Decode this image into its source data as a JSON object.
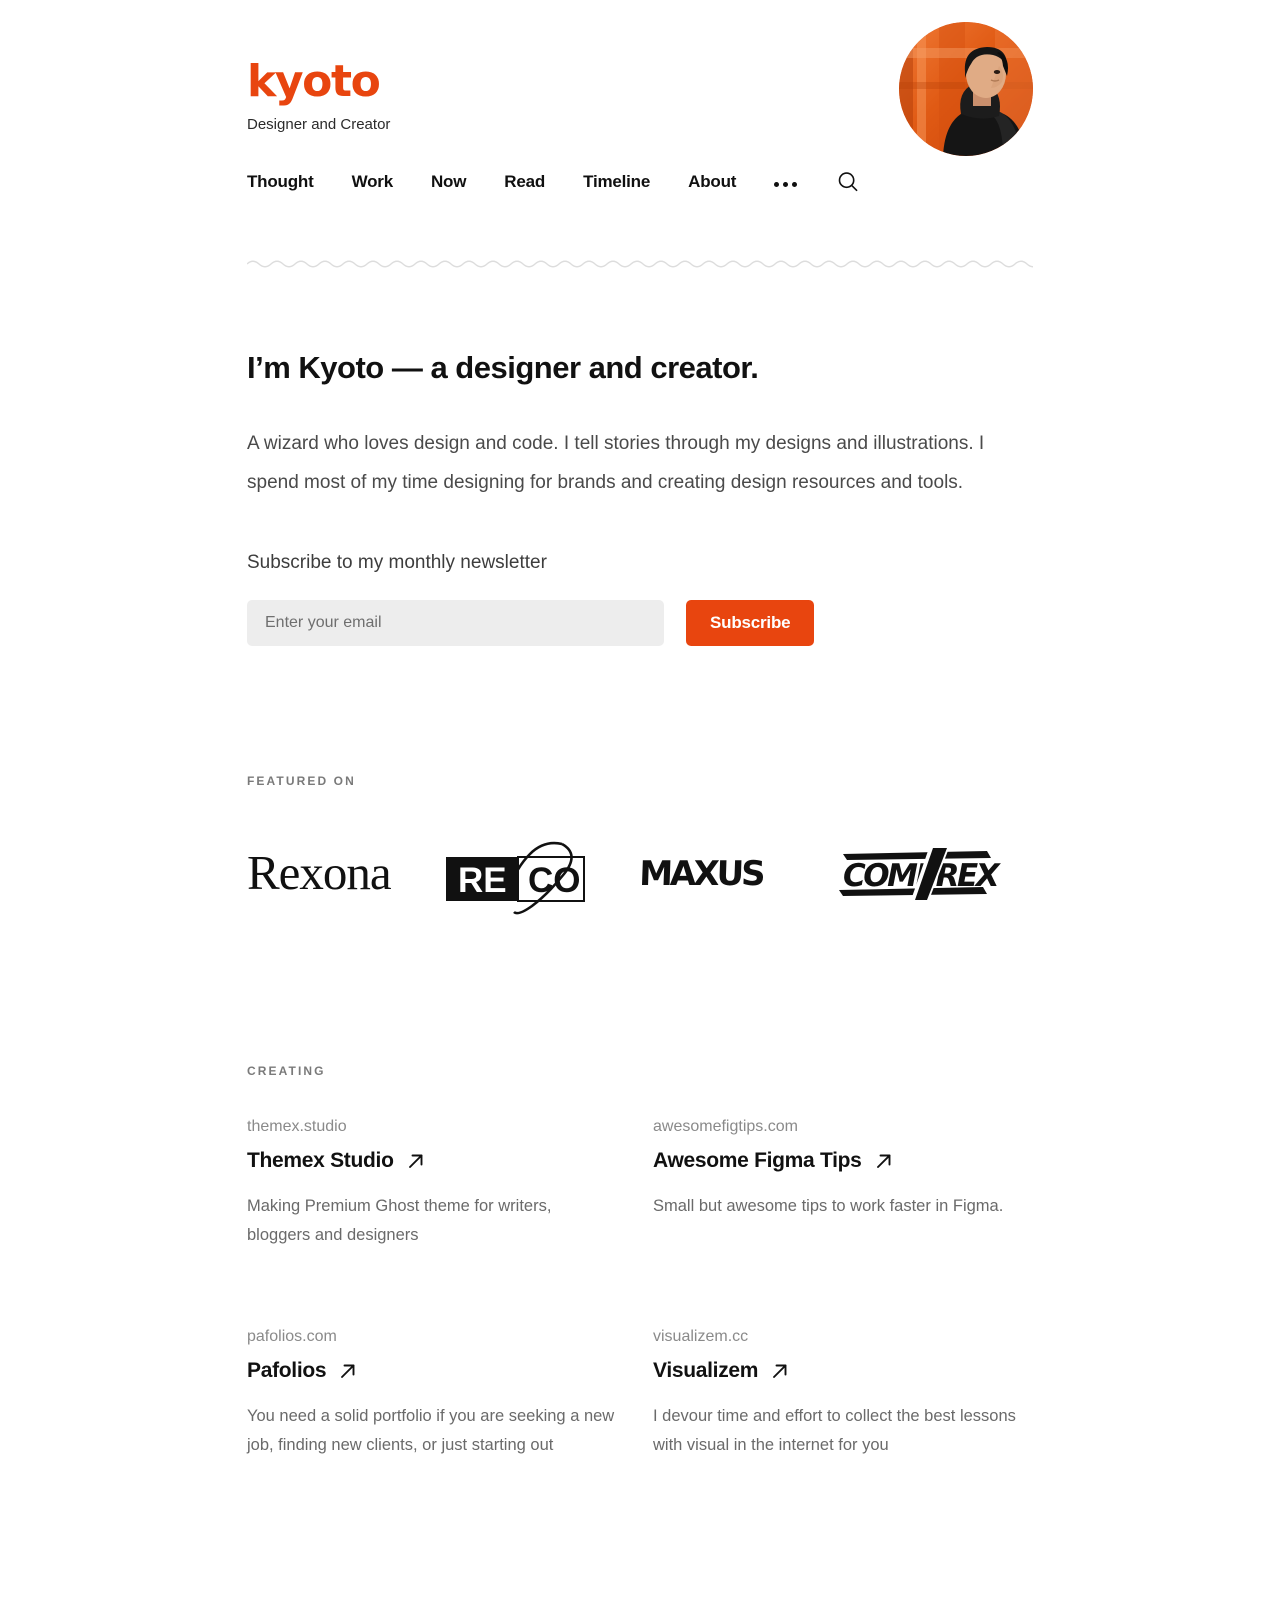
{
  "header": {
    "logo_text": "kyoto",
    "tagline": "Designer and Creator",
    "accent_color": "#E8450F",
    "avatar_alt": "avatar-photo",
    "nav": [
      {
        "label": "Thought"
      },
      {
        "label": "Work"
      },
      {
        "label": "Now"
      },
      {
        "label": "Read"
      },
      {
        "label": "Timeline"
      },
      {
        "label": "About"
      }
    ],
    "more_icon": "ellipsis-icon",
    "search_icon": "search-icon"
  },
  "intro": {
    "title": "I’m Kyoto — a designer and creator.",
    "body": "A wizard who loves design and code. I tell stories through my designs and illustrations. I spend most of my time designing for brands and creating design resources and tools."
  },
  "newsletter": {
    "label": "Subscribe to my monthly newsletter",
    "input_value": "",
    "placeholder": "Enter your email",
    "button_label": "Subscribe",
    "button_color": "#E8450F",
    "input_bg": "#EDEDED"
  },
  "featured": {
    "label": "FEATURED ON",
    "logos": [
      {
        "name": "Rexona",
        "icon": "rexona-logo"
      },
      {
        "name": "RECO",
        "icon": "reco-logo"
      },
      {
        "name": "MAXUS",
        "icon": "maxus-logo"
      },
      {
        "name": "COMPREX",
        "icon": "comprex-logo"
      }
    ]
  },
  "creating": {
    "label": "CREATING",
    "cards": [
      {
        "domain": "themex.studio",
        "title": "Themex Studio",
        "description": "Making Premium Ghost theme for writers, bloggers and designers",
        "link_icon": "arrow-up-right-icon"
      },
      {
        "domain": "awesomefigtips.com",
        "title": "Awesome Figma Tips",
        "description": "Small but awesome tips to work faster in Figma.",
        "link_icon": "arrow-up-right-icon"
      },
      {
        "domain": "pafolios.com",
        "title": "Pafolios",
        "description": "You need a solid portfolio if you are seeking a new job, finding new clients, or just starting out",
        "link_icon": "arrow-up-right-icon"
      },
      {
        "domain": "visualizem.cc",
        "title": "Visualizem",
        "description": "I devour time and effort to collect the best lessons with visual in the internet for you",
        "link_icon": "arrow-up-right-icon"
      }
    ]
  }
}
